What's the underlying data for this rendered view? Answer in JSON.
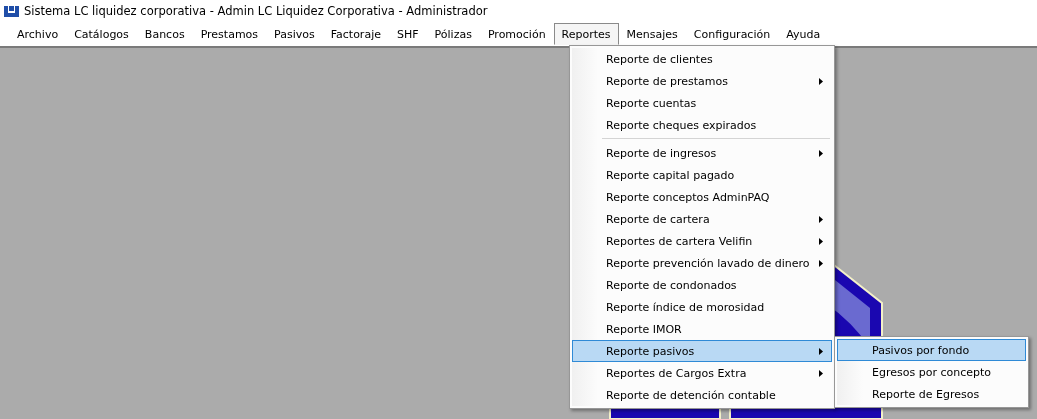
{
  "window": {
    "title": "Sistema LC liquidez corporativa - Admin LC Liquidez Corporativa - Administrador"
  },
  "menubar": [
    {
      "label": "Archivo",
      "selected": false
    },
    {
      "label": "Catálogos",
      "selected": false
    },
    {
      "label": "Bancos",
      "selected": false
    },
    {
      "label": "Prestamos",
      "selected": false
    },
    {
      "label": "Pasivos",
      "selected": false
    },
    {
      "label": "Factoraje",
      "selected": false
    },
    {
      "label": "SHF",
      "selected": false
    },
    {
      "label": "Pólizas",
      "selected": false
    },
    {
      "label": "Promoción",
      "selected": false
    },
    {
      "label": "Reportes",
      "selected": true
    },
    {
      "label": "Mensajes",
      "selected": false
    },
    {
      "label": "Configuración",
      "selected": false
    },
    {
      "label": "Ayuda",
      "selected": false
    }
  ],
  "dropdown": [
    {
      "kind": "item",
      "label": "Reporte de clientes",
      "submenu": false,
      "selected": false
    },
    {
      "kind": "item",
      "label": "Reporte de prestamos",
      "submenu": true,
      "selected": false
    },
    {
      "kind": "item",
      "label": "Reporte cuentas",
      "submenu": false,
      "selected": false
    },
    {
      "kind": "item",
      "label": "Reporte cheques expirados",
      "submenu": false,
      "selected": false
    },
    {
      "kind": "separator"
    },
    {
      "kind": "item",
      "label": "Reporte de ingresos",
      "submenu": true,
      "selected": false
    },
    {
      "kind": "item",
      "label": "Reporte capital pagado",
      "submenu": false,
      "selected": false
    },
    {
      "kind": "item",
      "label": "Reporte conceptos AdminPAQ",
      "submenu": false,
      "selected": false
    },
    {
      "kind": "item",
      "label": "Reporte de cartera",
      "submenu": true,
      "selected": false
    },
    {
      "kind": "item",
      "label": "Reportes de cartera Velifin",
      "submenu": true,
      "selected": false
    },
    {
      "kind": "item",
      "label": "Reporte prevención lavado de dinero",
      "submenu": true,
      "selected": false
    },
    {
      "kind": "item",
      "label": "Reporte de condonados",
      "submenu": false,
      "selected": false
    },
    {
      "kind": "item",
      "label": "Reporte índice de morosidad",
      "submenu": false,
      "selected": false
    },
    {
      "kind": "item",
      "label": "Reporte IMOR",
      "submenu": false,
      "selected": false
    },
    {
      "kind": "item",
      "label": "Reporte pasivos",
      "submenu": true,
      "selected": true
    },
    {
      "kind": "item",
      "label": "Reportes de Cargos Extra",
      "submenu": true,
      "selected": false
    },
    {
      "kind": "item",
      "label": "Reporte de detención contable",
      "submenu": false,
      "selected": false
    }
  ],
  "submenu": [
    {
      "label": "Pasivos por fondo",
      "selected": true
    },
    {
      "label": "Egresos por concepto",
      "selected": false
    },
    {
      "label": "Reporte de Egresos",
      "selected": false
    }
  ]
}
